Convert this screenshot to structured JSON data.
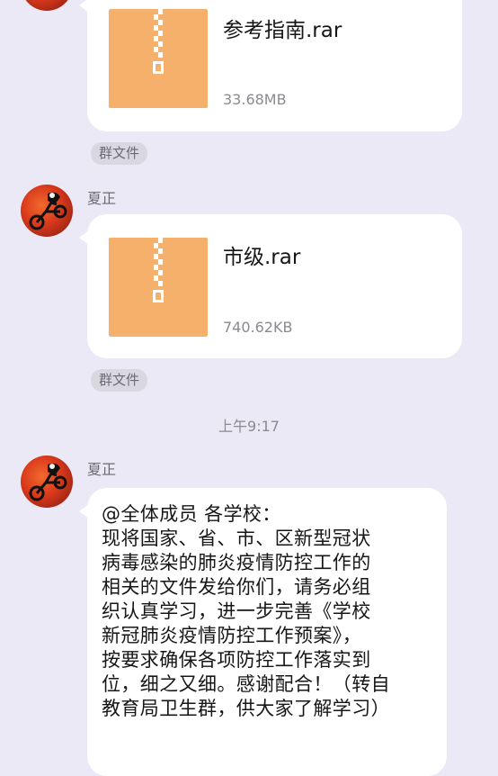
{
  "messages": [
    {
      "type": "file",
      "file_name": "参考指南.rar",
      "file_size": "33.68MB",
      "tag": "群文件"
    },
    {
      "type": "file",
      "sender": "夏正",
      "file_name": "市级.rar",
      "file_size": "740.62KB",
      "tag": "群文件"
    },
    {
      "type": "time",
      "time": "上午9:17"
    },
    {
      "type": "text",
      "sender": "夏正",
      "lines": [
        "@全体成员 各学校：",
        "现将国家、省、市、区新型冠状",
        "病毒感染的肺炎疫情防控工作的",
        "相关的文件发给你们，请务必组",
        "织认真学习，进一步完善《学校",
        "新冠肺炎疫情防控工作预案》，",
        "按要求确保各项防控工作落实到",
        "位，细之又细。感谢配合！（转自",
        "教育局卫生群，供大家了解学习）"
      ]
    }
  ],
  "colors": {
    "background": "#eae9f5",
    "bubble": "#ffffff",
    "file_icon": "#f5b06b",
    "avatar": "#d9381b"
  },
  "icons": {
    "file": "zip-archive-icon",
    "avatar": "cyclist-avatar"
  }
}
